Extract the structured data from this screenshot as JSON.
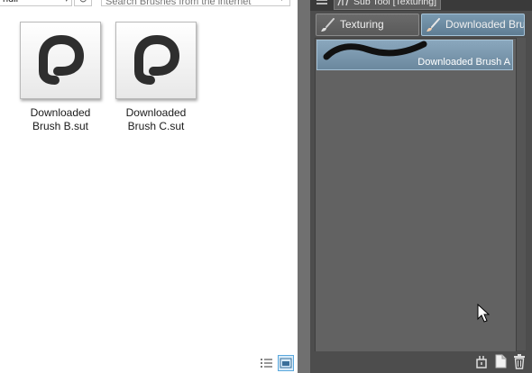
{
  "explorer": {
    "view_dropdown": {
      "value": "ndli",
      "options_visible": false
    },
    "search": {
      "placeholder": "Search Brushes from the internet"
    },
    "files": [
      {
        "name_line1": "Downloaded",
        "name_line2": "Brush B.sut",
        "icon": "clip-studio-logo-icon"
      },
      {
        "name_line1": "Downloaded",
        "name_line2": "Brush C.sut",
        "icon": "clip-studio-logo-icon"
      }
    ],
    "view_modes": {
      "details": "details-view-icon",
      "thumbnails": "thumbnail-view-icon"
    }
  },
  "panel": {
    "title": "Sub Tool [Texturing]",
    "group_tabs": [
      {
        "label": "Texturing",
        "selected": false,
        "icon": "brush-icon"
      },
      {
        "label": "Downloaded Brus",
        "selected": true,
        "icon": "brush-icon"
      }
    ],
    "brushes": [
      {
        "name": "Downloaded Brush A",
        "selected": true
      }
    ],
    "bottom_actions": [
      "sub-tool-settings-icon",
      "new-sub-tool-icon",
      "delete-icon"
    ]
  },
  "colors": {
    "panel_bg": "#4d4d4d",
    "list_bg": "#626262",
    "selected_blue": "#7a9ab1",
    "divider": "#707070"
  }
}
